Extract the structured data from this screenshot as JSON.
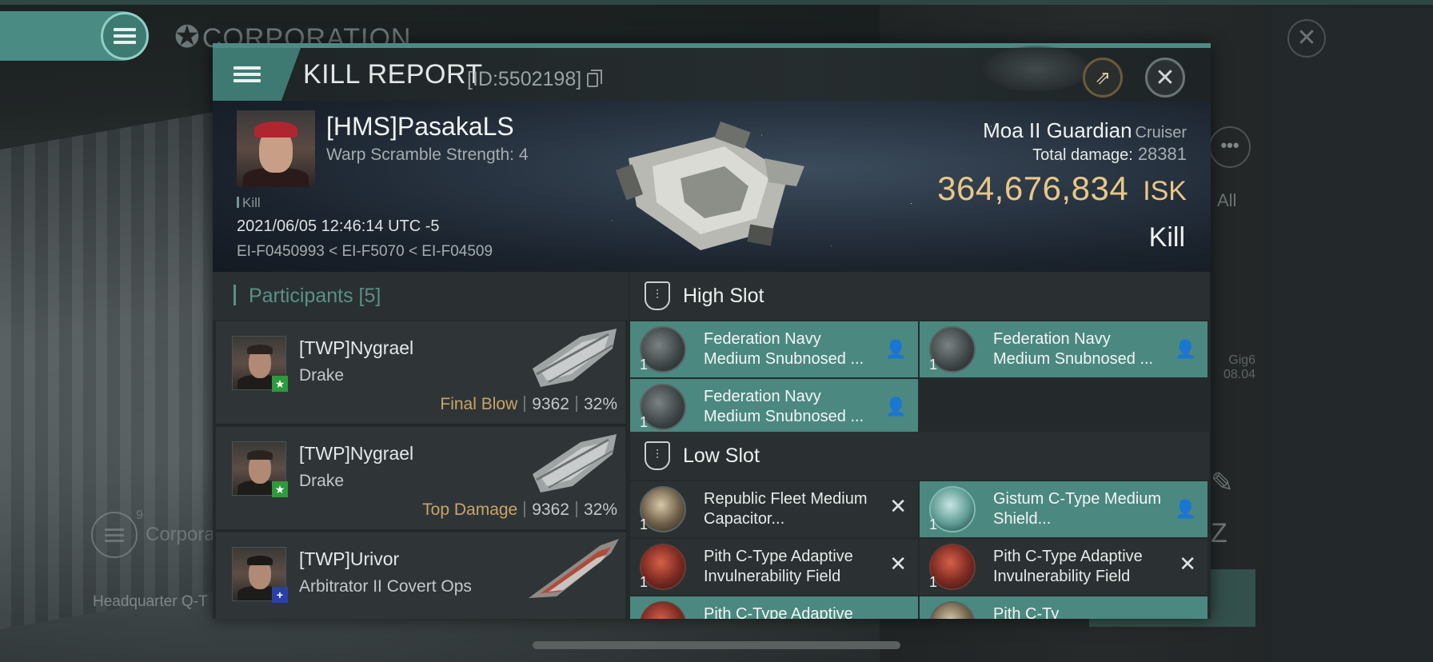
{
  "background": {
    "corp_title": "CORPORATION",
    "corp_bottom_label": "Corpora",
    "corp_bottom_count": "9",
    "hq_text": "Headquarter Q-T",
    "all_label": "All",
    "side_text_1": "Gig6",
    "side_text_2": "08.04"
  },
  "modal": {
    "title": "KILL REPORT",
    "id_text": "[ID:5502198]"
  },
  "victim": {
    "name": "[HMS]PasakaLS",
    "warp_scramble": "Warp Scramble Strength: 4",
    "kill_tag": "Kill",
    "datetime": "2021/06/05 12:46:14 UTC -5",
    "location": "EI-F0450993 < EI-F5070 < EI-F04509",
    "ship_name": "Moa II Guardian",
    "ship_class": "Cruiser",
    "total_damage_label": "Total damage:",
    "total_damage": "28381",
    "isk_value": "364,676,834",
    "isk_unit": "ISK",
    "result": "Kill"
  },
  "participants": {
    "label": "Participants",
    "count": "[5]",
    "rows": [
      {
        "name": "[TWP]Nygrael",
        "ship": "Drake",
        "tag": "Final Blow",
        "damage": "9362",
        "percent": "32%",
        "badge": "star"
      },
      {
        "name": "[TWP]Nygrael",
        "ship": "Drake",
        "tag": "Top Damage",
        "damage": "9362",
        "percent": "32%",
        "badge": "star"
      },
      {
        "name": "[TWP]Urivor",
        "ship": "Arbitrator II Covert Ops",
        "tag": "",
        "damage": "",
        "percent": "",
        "badge": "plus"
      }
    ]
  },
  "fitting": {
    "high_slot": {
      "title": "High Slot",
      "modules": [
        {
          "name": "Federation Navy Medium Snubnosed ...",
          "qty": "1",
          "status": "dropped"
        },
        {
          "name": "Federation Navy Medium Snubnosed ...",
          "qty": "1",
          "status": "dropped"
        },
        {
          "name": "Federation Navy Medium Snubnosed ...",
          "qty": "1",
          "status": "dropped"
        }
      ]
    },
    "low_slot": {
      "title": "Low Slot",
      "modules": [
        {
          "name": "Republic Fleet Medium Capacitor...",
          "qty": "1",
          "status": "destroyed"
        },
        {
          "name": "Gistum C-Type Medium Shield...",
          "qty": "1",
          "status": "dropped"
        },
        {
          "name": "Pith C-Type Adaptive Invulnerability Field",
          "qty": "1",
          "status": "destroyed"
        },
        {
          "name": "Pith C-Type Adaptive Invulnerability Field",
          "qty": "1",
          "status": "destroyed"
        },
        {
          "name": "Pith C-Type Adaptive",
          "qty": "",
          "status": "dropped"
        },
        {
          "name": "Pith  C-Ty",
          "qty": "",
          "status": "dropped"
        }
      ]
    }
  },
  "icons": {
    "dropped_status": "👤",
    "destroyed_status": "✕",
    "close": "✕",
    "share": "⇗",
    "corp_star": "✪"
  },
  "colors": {
    "accent": "#4b8880",
    "isk_gold": "#e8c887",
    "tag_gold": "#c9a46a"
  }
}
